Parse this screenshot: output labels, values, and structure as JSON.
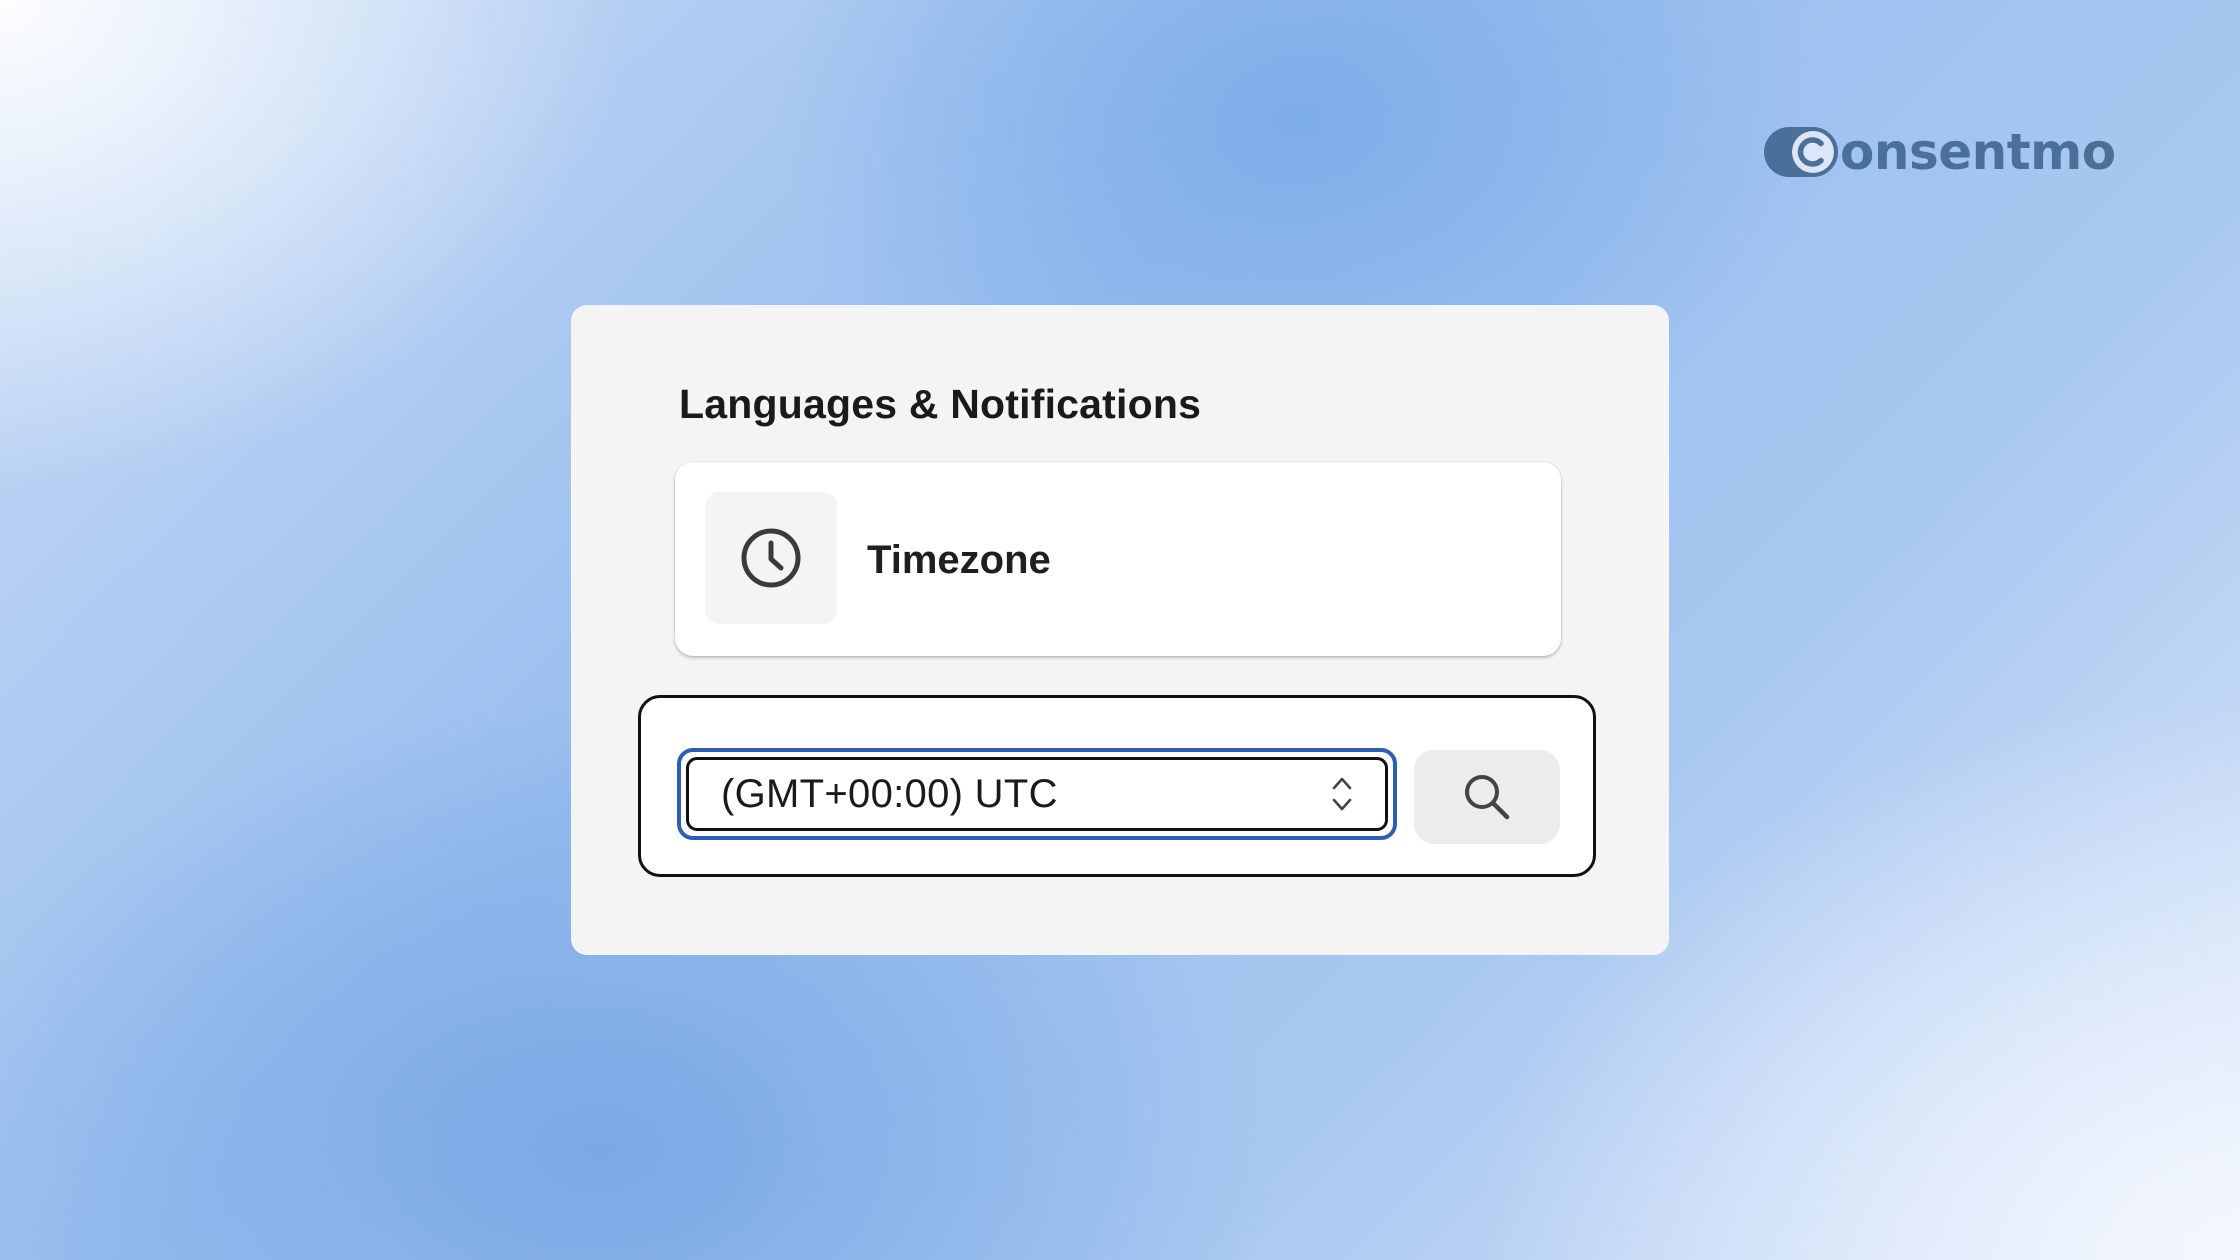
{
  "brand": {
    "name": "onsentmo",
    "mark_icon": "toggle-c-logo-icon",
    "color": "#4a6f98"
  },
  "panel": {
    "title": "Languages & Notifications"
  },
  "timezone_card": {
    "icon": "clock-icon",
    "label": "Timezone"
  },
  "timezone_select": {
    "value": "(GMT+00:00) UTC",
    "indicator_icon": "chevron-up-down-icon",
    "focus_color": "#2c5fb3"
  },
  "search_button": {
    "icon": "search-icon"
  }
}
